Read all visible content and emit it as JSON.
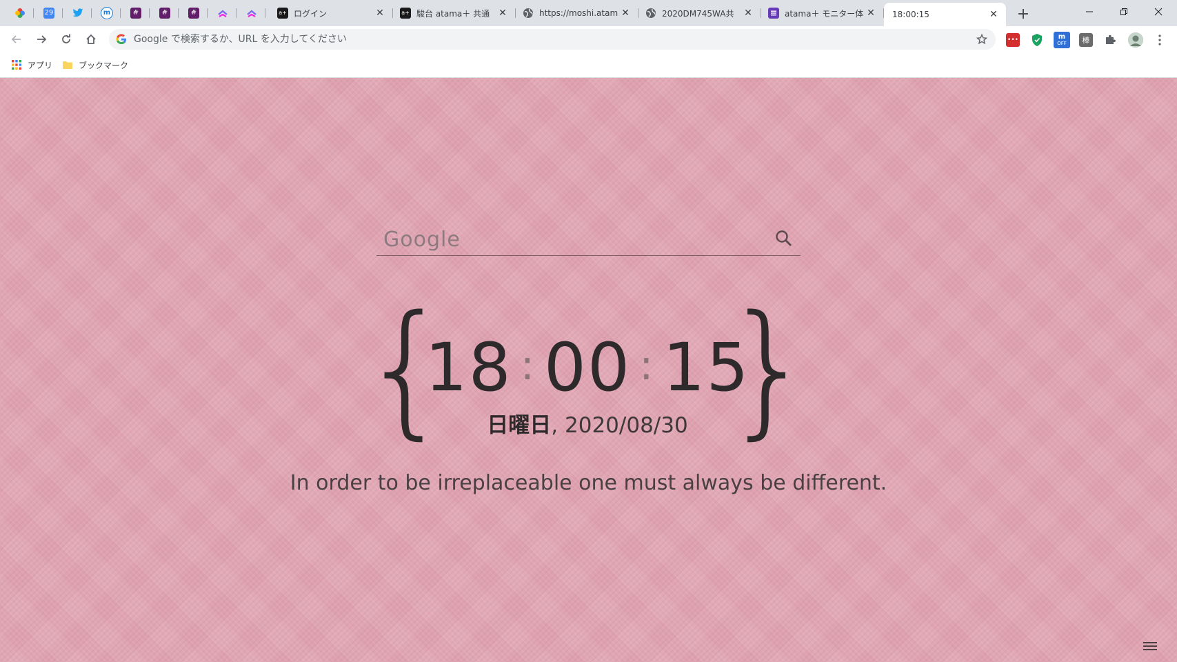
{
  "browser": {
    "tabs": [
      {
        "title": "ログイン",
        "icon": "atama-icon"
      },
      {
        "title": "駿台 atama＋ 共通",
        "icon": "atama-icon"
      },
      {
        "title": "https://moshi.atam",
        "icon": "globe-icon"
      },
      {
        "title": "2020DM745WA共",
        "icon": "globe-icon"
      },
      {
        "title": "atama＋ モニター体",
        "icon": "forms-icon"
      },
      {
        "title": "18:00:15",
        "icon": "none",
        "active": true
      }
    ],
    "pinned_tab_icons": [
      "pinwheel-icon",
      "calendar-icon",
      "twitter-icon",
      "m-icon",
      "slack-icon",
      "slack-icon",
      "slack-icon",
      "clickup-icon",
      "clickup-icon"
    ],
    "calendar_icon_text": "29",
    "address_bar": {
      "placeholder": "Google で検索するか、URL を入力してください",
      "value": ""
    },
    "extension_off_label": "OFF",
    "bookmarks": [
      {
        "label": "アプリ",
        "icon": "apps-grid-icon"
      },
      {
        "label": "ブックマーク",
        "icon": "folder-icon"
      }
    ]
  },
  "page": {
    "search": {
      "placeholder": "Google"
    },
    "clock": {
      "hours": "18",
      "minutes": "00",
      "seconds": "15",
      "brace_open": "{",
      "brace_close": "}",
      "separator": ":"
    },
    "date": {
      "day": "日曜日",
      "sep": ", ",
      "ymd": "2020/08/30"
    },
    "quote": "In order to be irreplaceable one must always be different."
  },
  "colors": {
    "background": "#e0a5b3",
    "text": "#2e2a2c",
    "tabbar": "#dee1e6"
  }
}
